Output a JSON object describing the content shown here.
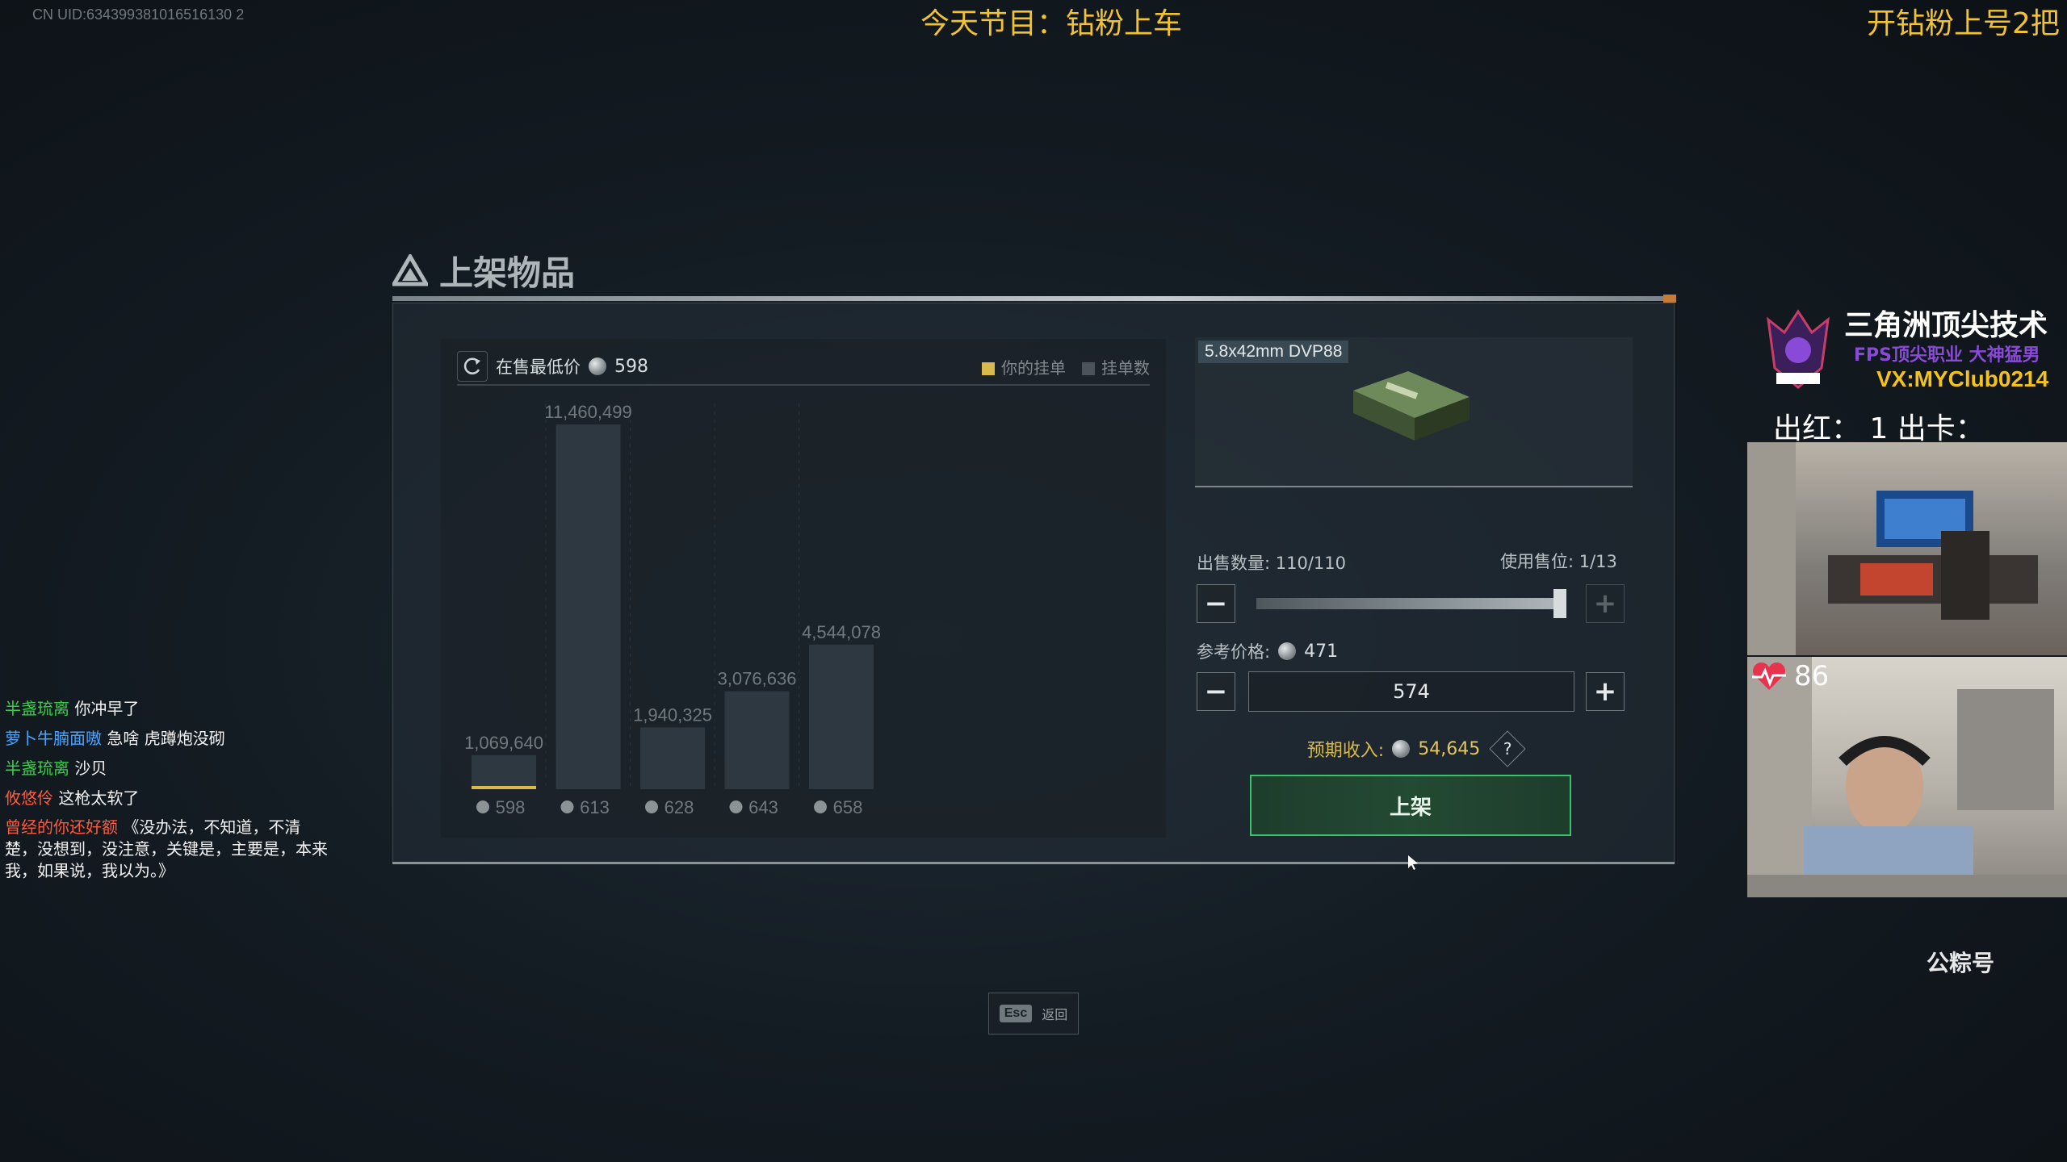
{
  "uid_text": "CN UID:634399381016516130 2",
  "stream_overlay": {
    "center_text": "今天节目：钻粉上车",
    "right_text": "开钻粉上号2把"
  },
  "dialog": {
    "title": "上架物品",
    "lowest_price_label": "在售最低价",
    "lowest_price_value": "598",
    "legend_yours": "你的挂单",
    "legend_count": "挂单数",
    "item_name": "5.8x42mm DVP88",
    "sell_qty_label": "出售数量: 110/110",
    "slots_label": "使用售位: 1/13",
    "ref_price_label": "参考价格:",
    "ref_price_value": "471",
    "price_input_value": "574",
    "income_label": "预期收入:",
    "income_value": "54,645",
    "list_button": "上架",
    "esc_key": "Esc",
    "esc_label": "返回"
  },
  "chart_data": {
    "type": "bar",
    "categories": [
      "598",
      "613",
      "628",
      "643",
      "658"
    ],
    "values": [
      1069640,
      11460499,
      1940325,
      3076636,
      4544078
    ],
    "value_labels": [
      "1,069,640",
      "11,460,499",
      "1,940,325",
      "3,076,636",
      "4,544,078"
    ],
    "highlight_category": "598",
    "legend": [
      "你的挂单",
      "挂单数"
    ],
    "ylim": [
      0,
      11460499
    ]
  },
  "colors": {
    "accent_yellow": "#d8b94a",
    "bar": "#2e3840",
    "list_button_border": "#35c46a"
  },
  "chat": [
    {
      "user": "半盏琉离",
      "msg": "你冲早了",
      "color": "green"
    },
    {
      "user": "萝卜牛腩面嗷",
      "msg": "急啥 虎蹲炮没砌",
      "color": "blue"
    },
    {
      "user": "半盏琉离",
      "msg": "沙贝",
      "color": "green"
    },
    {
      "user": "攸悠伶",
      "msg": "这枪太软了",
      "color": "red"
    },
    {
      "user": "曾经的你还好额",
      "msg": "《没办法，不知道，不清楚，没想到，没注意，关键是，主要是，本来我，如果说，我以为。》",
      "color": "red"
    }
  ],
  "streamer": {
    "brand_title": "三角洲顶尖技术",
    "brand_sub": "FPS顶尖职业 大神猛男",
    "brand_vx": "VX:MYClub0214",
    "stat_line": "出红：  1   出卡：",
    "heart_rate": "86",
    "watermark": "公粽号"
  }
}
